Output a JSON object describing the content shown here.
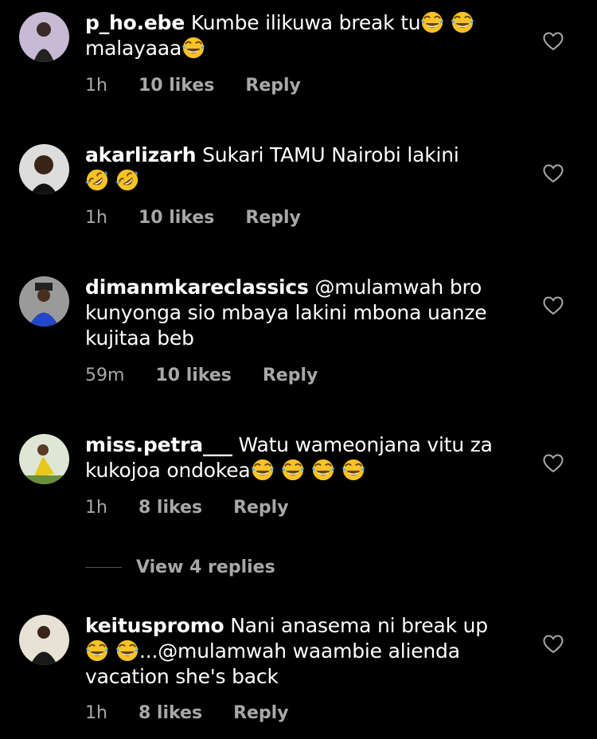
{
  "comments": [
    {
      "username": "p_ho.ebe",
      "text": "Kumbe ilikuwa break tu",
      "text2": "malayaaa",
      "time": "1h",
      "likes": "10 likes",
      "reply": "Reply"
    },
    {
      "username": "akarlizarh",
      "text": "Sukari TAMU  Nairobi lakini",
      "time": "1h",
      "likes": "10 likes",
      "reply": "Reply"
    },
    {
      "username": "dimanmkareclassics",
      "text": "@mulamwah  bro",
      "text2": "kunyonga sio mbaya lakini mbona uanze",
      "text3": "kujitaa beb",
      "time": "59m",
      "likes": "10 likes",
      "reply": "Reply"
    },
    {
      "username": "miss.petra___",
      "text": "Watu wameonjana vitu za",
      "text2": "kukojoa ondokea",
      "time": "1h",
      "likes": "8 likes",
      "reply": "Reply"
    },
    {
      "username": "keituspromo",
      "text": "Nani anasema ni break up",
      "text2": "...@mulamwah  waambie alienda",
      "text3": "vacation she's back",
      "time": "1h",
      "likes": "8 likes",
      "reply": "Reply"
    }
  ],
  "view_replies": "View 4 replies",
  "icons": {
    "heart": "heart-outline-icon",
    "laugh": "face-with-tears-of-joy-emoji",
    "rofl": "rolling-on-floor-laughing-emoji"
  }
}
